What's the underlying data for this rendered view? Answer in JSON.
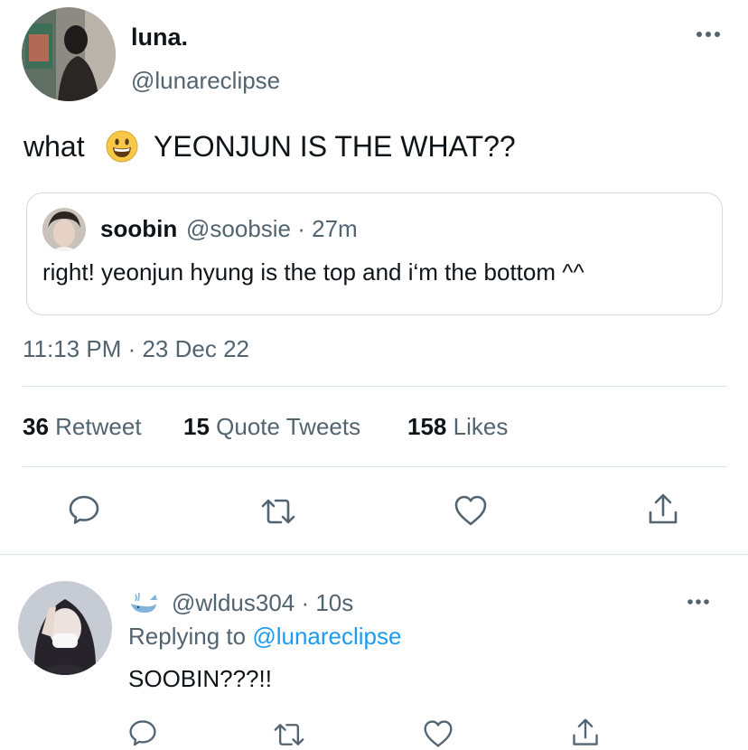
{
  "tweet": {
    "display_name": "luna.",
    "handle": "@lunareclipse",
    "text_before_emoji": "what",
    "text_after_emoji": "YEONJUN IS THE WHAT??",
    "emoji": "grinning-face",
    "timestamp": "11:13 PM · 23 Dec 22",
    "stats": {
      "retweets_count": "36",
      "retweets_label": "Retweet",
      "quotes_count": "15",
      "quotes_label": "Quote Tweets",
      "likes_count": "158",
      "likes_label": "Likes"
    },
    "actions": [
      "reply-icon",
      "retweet-icon",
      "like-icon",
      "share-icon"
    ]
  },
  "quote": {
    "display_name": "soobin",
    "meta": "@soobsie · 27m",
    "text": "right! yeonjun hyung is the top and i‘m the bottom ^^"
  },
  "reply": {
    "head": "@wldus304 · 10s",
    "replying_prefix": "Replying to",
    "replying_to": "@lunareclipse",
    "text": "SOOBIN???!!",
    "actions": [
      "reply-icon",
      "retweet-icon",
      "like-icon",
      "share-icon"
    ]
  },
  "colors": {
    "text": "#0f1419",
    "secondary": "#536471",
    "link": "#1d9bf0",
    "border": "#cfd9de"
  }
}
